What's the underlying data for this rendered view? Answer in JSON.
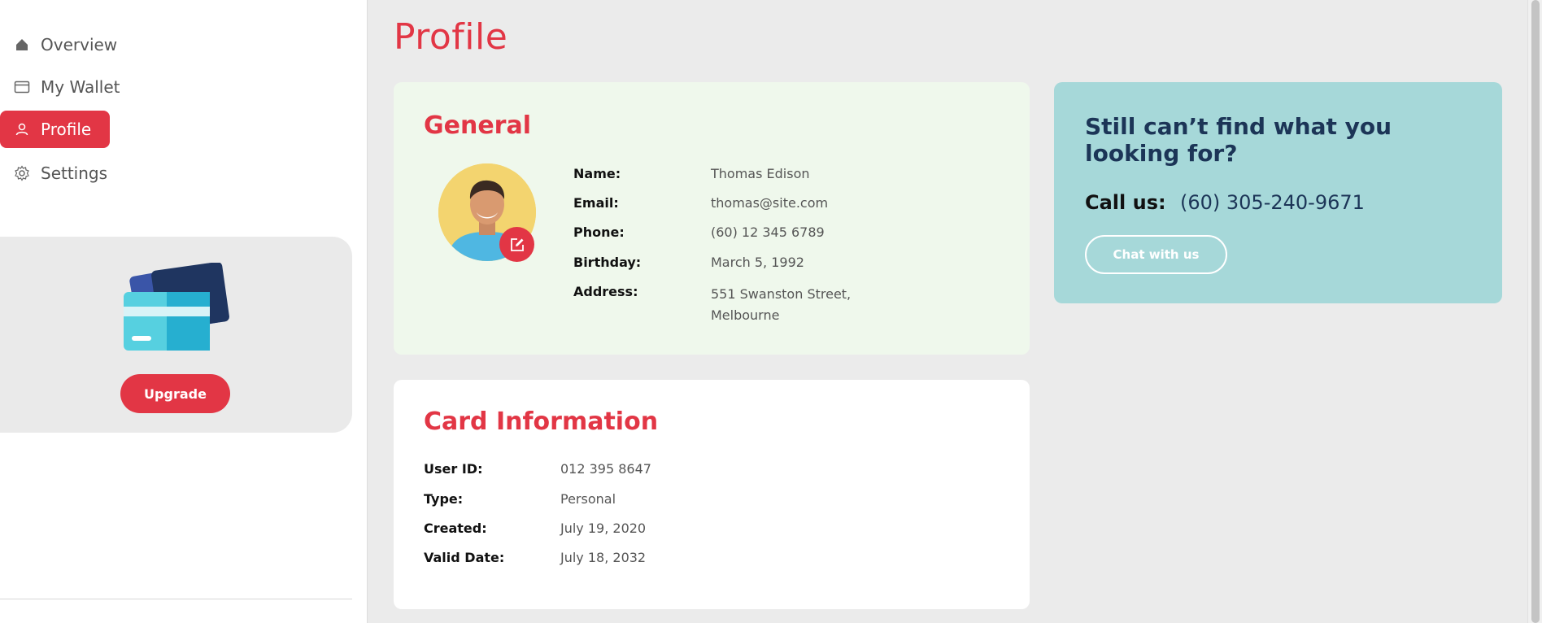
{
  "sidebar": {
    "items": [
      {
        "label": "Overview",
        "icon": "home-icon"
      },
      {
        "label": "My Wallet",
        "icon": "wallet-icon"
      },
      {
        "label": "Profile",
        "icon": "user-icon",
        "active": true
      },
      {
        "label": "Settings",
        "icon": "gear-icon"
      }
    ],
    "upgrade": {
      "button_label": "Upgrade",
      "art": "credit-cards-illustration"
    }
  },
  "page": {
    "title": "Profile"
  },
  "general": {
    "heading": "General",
    "avatar": "avatar-photo",
    "fields": [
      {
        "label": "Name:",
        "value": "Thomas Edison"
      },
      {
        "label": "Email:",
        "value": "thomas@site.com"
      },
      {
        "label": "Phone:",
        "value": "(60) 12 345 6789"
      },
      {
        "label": "Birthday:",
        "value": "March 5, 1992"
      },
      {
        "label": "Address:",
        "value": "551 Swanston Street, Melbourne"
      }
    ]
  },
  "card_info": {
    "heading": "Card Information",
    "fields": [
      {
        "label": "User ID:",
        "value": "012 395 8647"
      },
      {
        "label": "Type:",
        "value": "Personal"
      },
      {
        "label": "Created:",
        "value": "July 19, 2020"
      },
      {
        "label": "Valid Date:",
        "value": "July 18, 2032"
      }
    ]
  },
  "help": {
    "title": "Still can’t find what you looking for?",
    "call_label": "Call us:",
    "call_value": "(60) 305-240-9671",
    "chat_button": "Chat with us"
  },
  "colors": {
    "accent": "#e23645",
    "general_bg": "#eff8ec",
    "help_bg": "#a6d8d9",
    "help_title": "#1c3557",
    "page_bg": "#ebebeb"
  }
}
